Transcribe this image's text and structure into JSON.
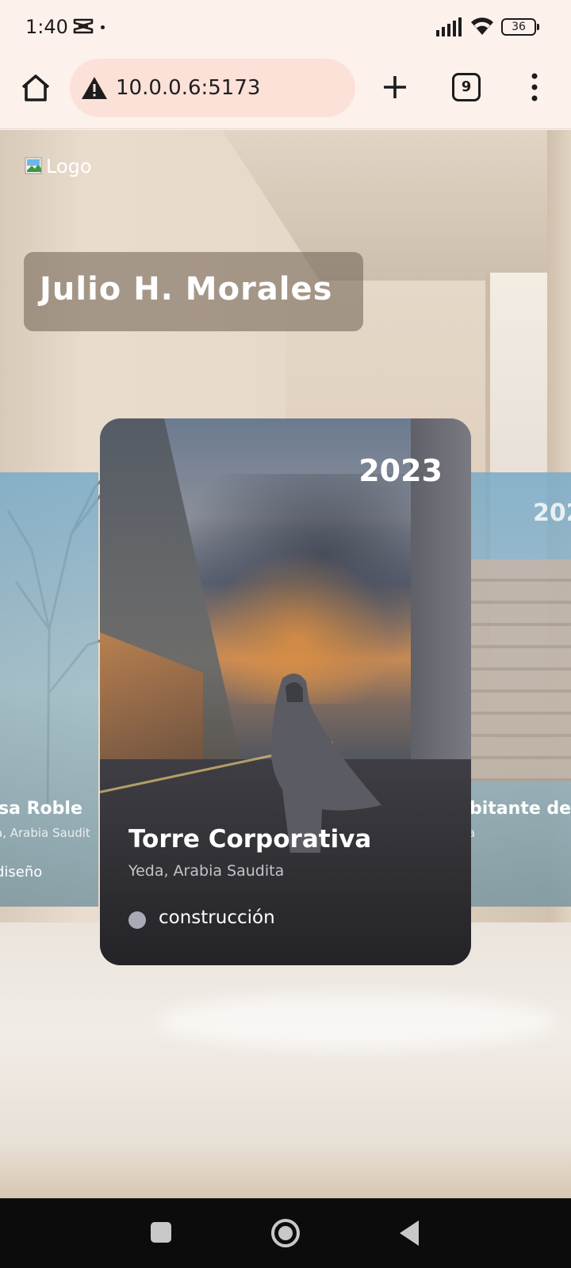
{
  "status_bar": {
    "time": "1:40",
    "app_icon": "capcut-icon",
    "battery": "36"
  },
  "browser": {
    "url": "10.0.0.6:5173",
    "tab_count": "9",
    "icons": [
      "home-icon",
      "warning-icon",
      "plus-icon",
      "tabs-icon",
      "more-vert-icon"
    ]
  },
  "page": {
    "logo_alt": "Logo",
    "name": "Julio H. Morales",
    "cards": {
      "left": {
        "title": "sa Roble",
        "location": "a, Arabia Saudit",
        "status": "diseño"
      },
      "main": {
        "year": "2023",
        "title": "Torre Corporativa",
        "location": "Yeda, Arabia Saudita",
        "status": "construcción"
      },
      "right": {
        "year": "202",
        "title": "bitante de",
        "location": "a"
      }
    }
  },
  "colors": {
    "chrome_bg": "#fdf1ec",
    "url_bar_bg": "#fbe1d8",
    "status_dot": "#a9aab8"
  }
}
